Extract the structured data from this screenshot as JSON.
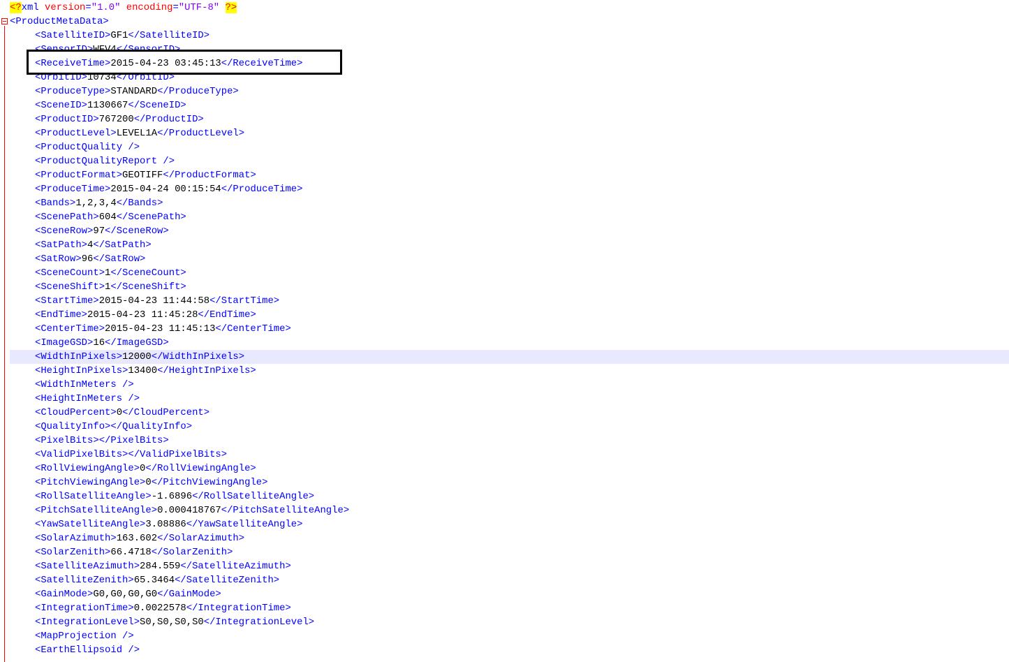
{
  "declaration": {
    "open": "<?",
    "name": "xml",
    "attr1_name": "version",
    "attr1_value": "\"1.0\"",
    "attr2_name": "encoding",
    "attr2_value": "\"UTF-8\"",
    "close": "?>"
  },
  "root_tag": "<ProductMetaData>",
  "lines": [
    {
      "open": "<SatelliteID>",
      "value": "GF1",
      "close": "</SatelliteID>"
    },
    {
      "open": "<SensorID>",
      "value": "WFV4",
      "close": "</SensorID>"
    },
    {
      "open": "<ReceiveTime>",
      "value": "2015-04-23 03:45:13",
      "close": "</ReceiveTime>"
    },
    {
      "open": "<OrbitID>",
      "value": "10734",
      "close": "</OrbitID>"
    },
    {
      "open": "<ProduceType>",
      "value": "STANDARD",
      "close": "</ProduceType>"
    },
    {
      "open": "<SceneID>",
      "value": "1130667",
      "close": "</SceneID>"
    },
    {
      "open": "<ProductID>",
      "value": "767200",
      "close": "</ProductID>"
    },
    {
      "open": "<ProductLevel>",
      "value": "LEVEL1A",
      "close": "</ProductLevel>"
    },
    {
      "open": "<ProductQuality />",
      "value": "",
      "close": ""
    },
    {
      "open": "<ProductQualityReport />",
      "value": "",
      "close": ""
    },
    {
      "open": "<ProductFormat>",
      "value": "GEOTIFF",
      "close": "</ProductFormat>"
    },
    {
      "open": "<ProduceTime>",
      "value": "2015-04-24 00:15:54",
      "close": "</ProduceTime>"
    },
    {
      "open": "<Bands>",
      "value": "1,2,3,4",
      "close": "</Bands>"
    },
    {
      "open": "<ScenePath>",
      "value": "604",
      "close": "</ScenePath>"
    },
    {
      "open": "<SceneRow>",
      "value": "97",
      "close": "</SceneRow>"
    },
    {
      "open": "<SatPath>",
      "value": "4",
      "close": "</SatPath>"
    },
    {
      "open": "<SatRow>",
      "value": "96",
      "close": "</SatRow>"
    },
    {
      "open": "<SceneCount>",
      "value": "1",
      "close": "</SceneCount>"
    },
    {
      "open": "<SceneShift>",
      "value": "1",
      "close": "</SceneShift>"
    },
    {
      "open": "<StartTime>",
      "value": "2015-04-23 11:44:58",
      "close": "</StartTime>"
    },
    {
      "open": "<EndTime>",
      "value": "2015-04-23 11:45:28",
      "close": "</EndTime>"
    },
    {
      "open": "<CenterTime>",
      "value": "2015-04-23 11:45:13",
      "close": "</CenterTime>"
    },
    {
      "open": "<ImageGSD>",
      "value": "16",
      "close": "</ImageGSD>"
    },
    {
      "open": "<WidthInPixels>",
      "value": "12000",
      "close": "</WidthInPixels>",
      "current": true
    },
    {
      "open": "<HeightInPixels>",
      "value": "13400",
      "close": "</HeightInPixels>"
    },
    {
      "open": "<WidthInMeters />",
      "value": "",
      "close": ""
    },
    {
      "open": "<HeightInMeters />",
      "value": "",
      "close": ""
    },
    {
      "open": "<CloudPercent>",
      "value": "0",
      "close": "</CloudPercent>"
    },
    {
      "open": "<QualityInfo>",
      "value": "",
      "close": "</QualityInfo>"
    },
    {
      "open": "<PixelBits>",
      "value": "",
      "close": "</PixelBits>"
    },
    {
      "open": "<ValidPixelBits>",
      "value": "",
      "close": "</ValidPixelBits>"
    },
    {
      "open": "<RollViewingAngle>",
      "value": "0",
      "close": "</RollViewingAngle>"
    },
    {
      "open": "<PitchViewingAngle>",
      "value": "0",
      "close": "</PitchViewingAngle>"
    },
    {
      "open": "<RollSatelliteAngle>",
      "value": "-1.6896",
      "close": "</RollSatelliteAngle>"
    },
    {
      "open": "<PitchSatelliteAngle>",
      "value": "0.000418767",
      "close": "</PitchSatelliteAngle>"
    },
    {
      "open": "<YawSatelliteAngle>",
      "value": "3.08886",
      "close": "</YawSatelliteAngle>"
    },
    {
      "open": "<SolarAzimuth>",
      "value": "163.602",
      "close": "</SolarAzimuth>"
    },
    {
      "open": "<SolarZenith>",
      "value": "66.4718",
      "close": "</SolarZenith>"
    },
    {
      "open": "<SatelliteAzimuth>",
      "value": "284.559",
      "close": "</SatelliteAzimuth>"
    },
    {
      "open": "<SatelliteZenith>",
      "value": "65.3464",
      "close": "</SatelliteZenith>"
    },
    {
      "open": "<GainMode>",
      "value": "G0,G0,G0,G0",
      "close": "</GainMode>"
    },
    {
      "open": "<IntegrationTime>",
      "value": "0.0022578",
      "close": "</IntegrationTime>"
    },
    {
      "open": "<IntegrationLevel>",
      "value": "S0,S0,S0,S0",
      "close": "</IntegrationLevel>"
    },
    {
      "open": "<MapProjection />",
      "value": "",
      "close": ""
    },
    {
      "open": "<EarthEllipsoid />",
      "value": "",
      "close": ""
    }
  ],
  "colors": {
    "tag": "#0000ff",
    "attribute": "#ff0000",
    "attribute_value": "#8000ff",
    "text": "#000000",
    "current_line": "#e8e8ff",
    "fold_marker": "#ff0000"
  },
  "icons": {
    "fold": "fold-minus-icon"
  }
}
